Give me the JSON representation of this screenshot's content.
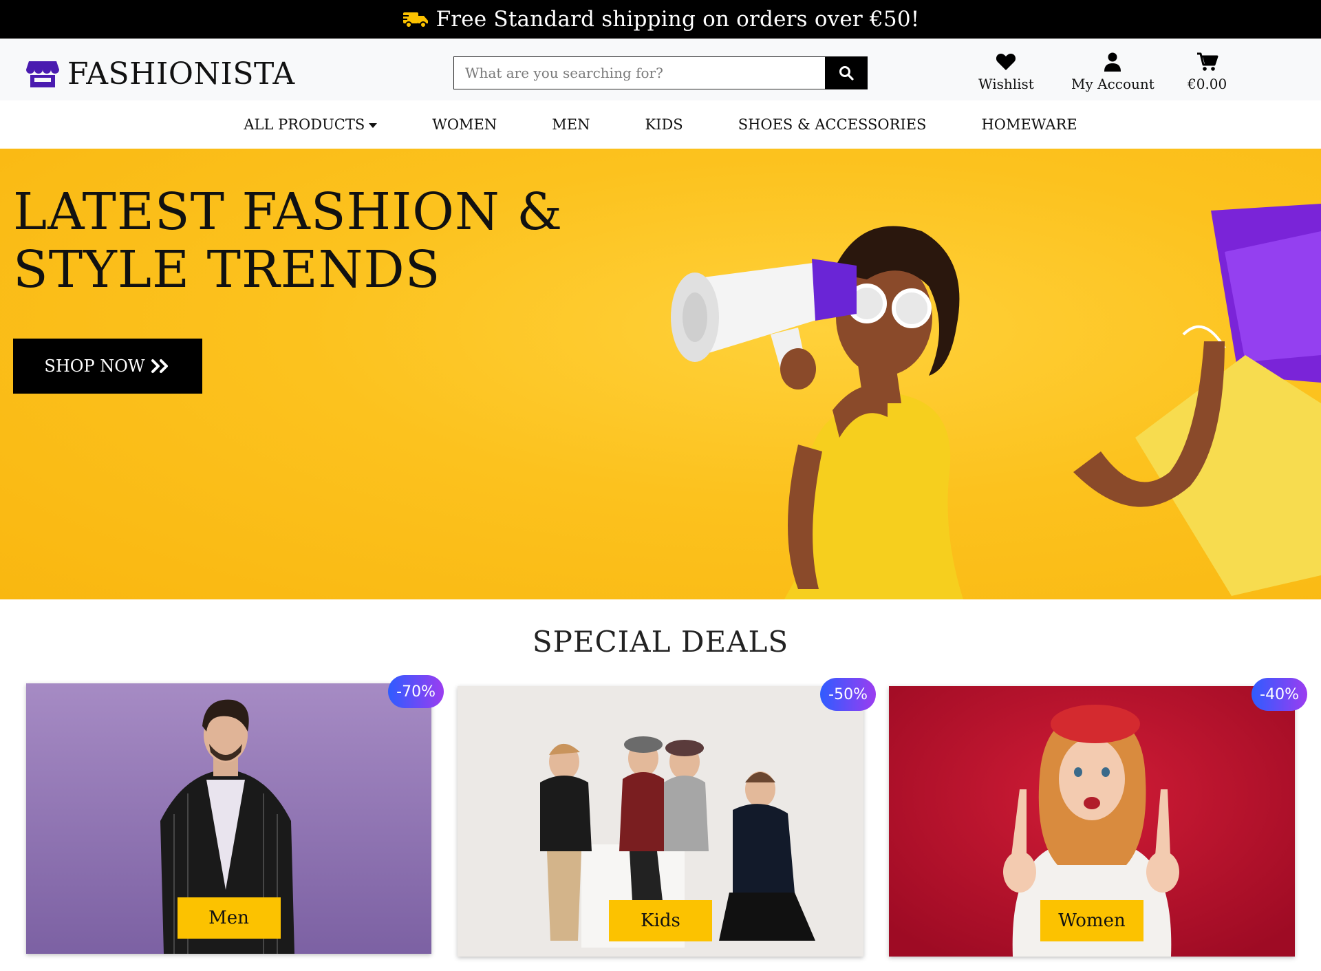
{
  "topbar": {
    "message": "Free Standard shipping on orders over €50!",
    "icon": "truck-icon"
  },
  "header": {
    "logo_text": "FASHIONISTA",
    "search": {
      "placeholder": "What are you searching for?",
      "value": ""
    },
    "wishlist": "Wishlist",
    "account": "My Account",
    "cart_total": "€0.00"
  },
  "nav": {
    "items": [
      "ALL PRODUCTS",
      "WOMEN",
      "MEN",
      "KIDS",
      "SHOES & ACCESSORIES",
      "HOMEWARE"
    ]
  },
  "hero": {
    "title": "LATEST FASHION & STYLE TRENDS",
    "cta": "SHOP NOW"
  },
  "deals": {
    "title": "SPECIAL DEALS",
    "cards": [
      {
        "label": "Men",
        "discount": "-70%"
      },
      {
        "label": "Kids",
        "discount": "-50%"
      },
      {
        "label": "Women",
        "discount": "-40%"
      }
    ]
  },
  "colors": {
    "accent": "#fcc200",
    "hero_bg": "#fcc21e",
    "logo": "#4a1bb0",
    "badge_start": "#2f5cff",
    "badge_end": "#9b3df0"
  }
}
